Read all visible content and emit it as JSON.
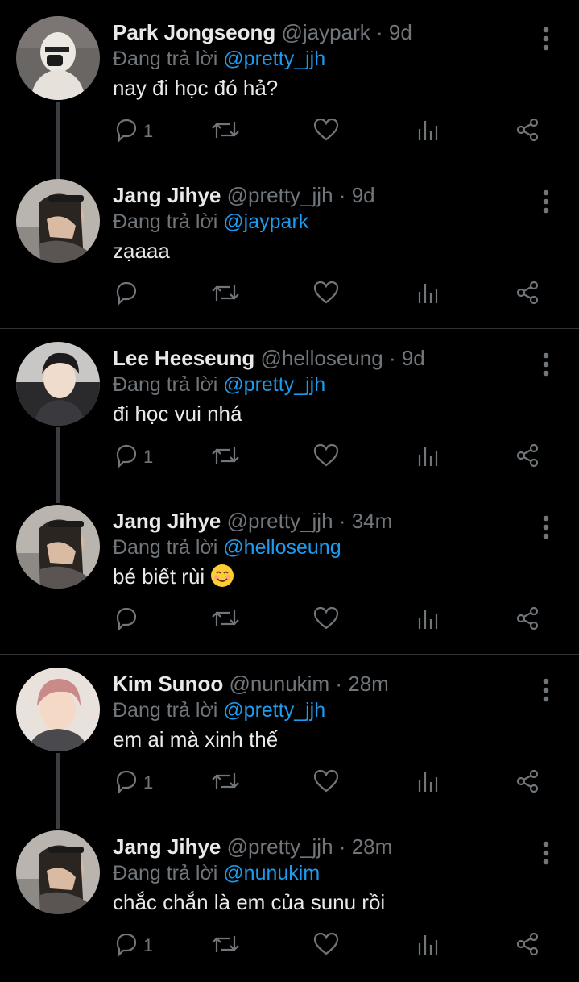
{
  "reply_prefix": "Đang trả lời",
  "tweets": [
    {
      "name": "Park Jongseong",
      "handle": "@jaypark",
      "dot": "·",
      "time": "9d",
      "reply_to": "@pretty_jjh",
      "text": "nay đi học đó hả?",
      "reply_count": "1",
      "avatar": "avatar-park-jongseong"
    },
    {
      "name": "Jang Jihye",
      "handle": "@pretty_jjh",
      "dot": "·",
      "time": "9d",
      "reply_to": "@jaypark",
      "text": "zạaaa",
      "reply_count": "",
      "avatar": "avatar-jang-jihye"
    },
    {
      "name": "Lee Heeseung",
      "handle": "@helloseung",
      "dot": "·",
      "time": "9d",
      "reply_to": "@pretty_jjh",
      "text": "đi học vui nhá",
      "reply_count": "1",
      "avatar": "avatar-lee-heeseung"
    },
    {
      "name": "Jang Jihye",
      "handle": "@pretty_jjh",
      "dot": "·",
      "time": "34m",
      "reply_to": "@helloseung",
      "text": "bé biết rùi",
      "emoji": "smiling-face-emoji",
      "reply_count": "",
      "avatar": "avatar-jang-jihye"
    },
    {
      "name": "Kim Sunoo",
      "handle": "@nunukim",
      "dot": "·",
      "time": "28m",
      "reply_to": "@pretty_jjh",
      "text": "em ai mà xinh thế",
      "reply_count": "1",
      "avatar": "avatar-kim-sunoo"
    },
    {
      "name": "Jang Jihye",
      "handle": "@pretty_jjh",
      "dot": "·",
      "time": "28m",
      "reply_to": "@nunukim",
      "text": "chắc chắn là em của sunu rồi",
      "reply_count": "1",
      "avatar": "avatar-jang-jihye"
    }
  ],
  "colors": {
    "background": "#000000",
    "text": "#e7e9ea",
    "muted": "#71767b",
    "accent": "#1d9bf0",
    "thread_line": "#3a3d41",
    "divider": "#2f3336"
  },
  "icons": {
    "more": "more-vertical-icon",
    "reply": "reply-icon",
    "retweet": "retweet-icon",
    "like": "like-icon",
    "views": "views-icon",
    "share": "share-icon"
  }
}
